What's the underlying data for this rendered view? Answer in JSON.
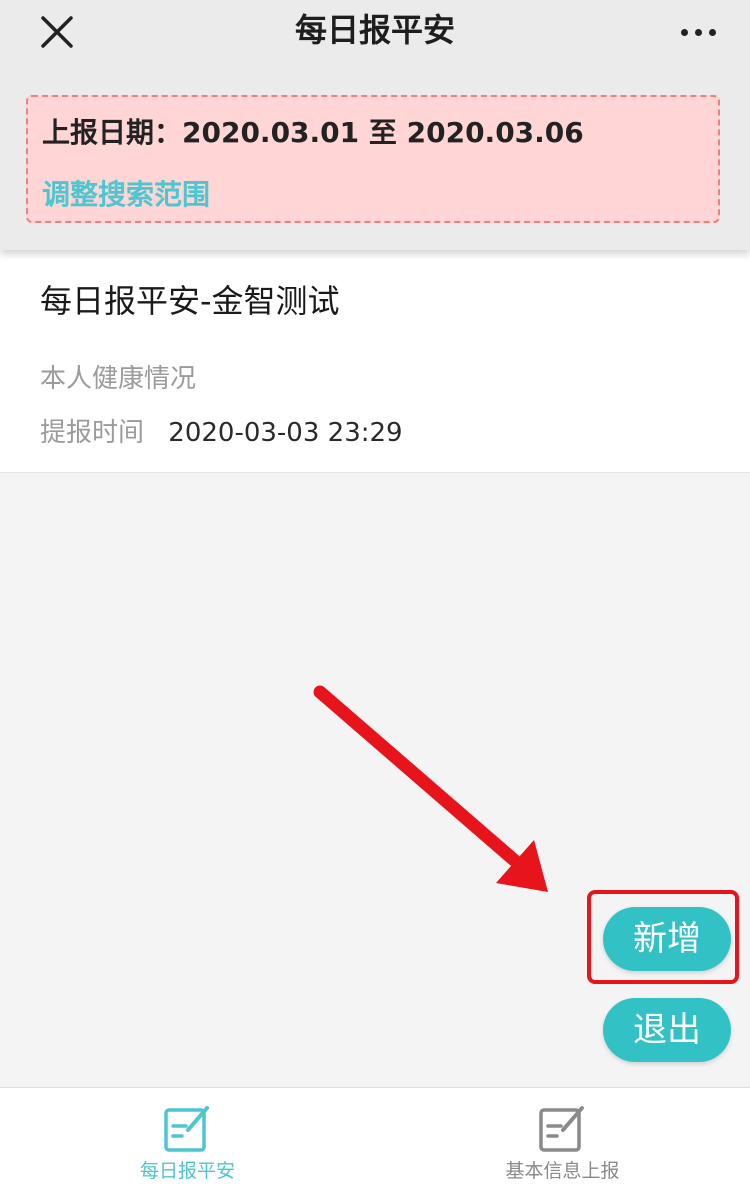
{
  "header": {
    "title": "每日报平安",
    "icons": {
      "close": "close-icon",
      "more": "more-icon"
    }
  },
  "filter": {
    "date_range_text": "上报日期：2020.03.01 至 2020.03.06",
    "adjust_link": "调整搜索范围",
    "colors": {
      "box_background": "#ffd5d6",
      "box_border": "#f08080",
      "link": "#4cc6cf"
    }
  },
  "records": [
    {
      "title": "每日报平安-金智测试",
      "health_label": "本人健康情况",
      "time_label": "提报时间",
      "time_value": "2020-03-03 23:29"
    }
  ],
  "actions": {
    "add_label": "新增",
    "exit_label": "退出",
    "button_color": "#32c2c6",
    "annotation_color": "#e8141b"
  },
  "tabs": [
    {
      "label": "每日报平安",
      "icon": "edit-form-icon",
      "active": true,
      "color": "#4cc6cf"
    },
    {
      "label": "基本信息上报",
      "icon": "edit-form-icon",
      "active": false,
      "color": "#8a8a8a"
    }
  ]
}
